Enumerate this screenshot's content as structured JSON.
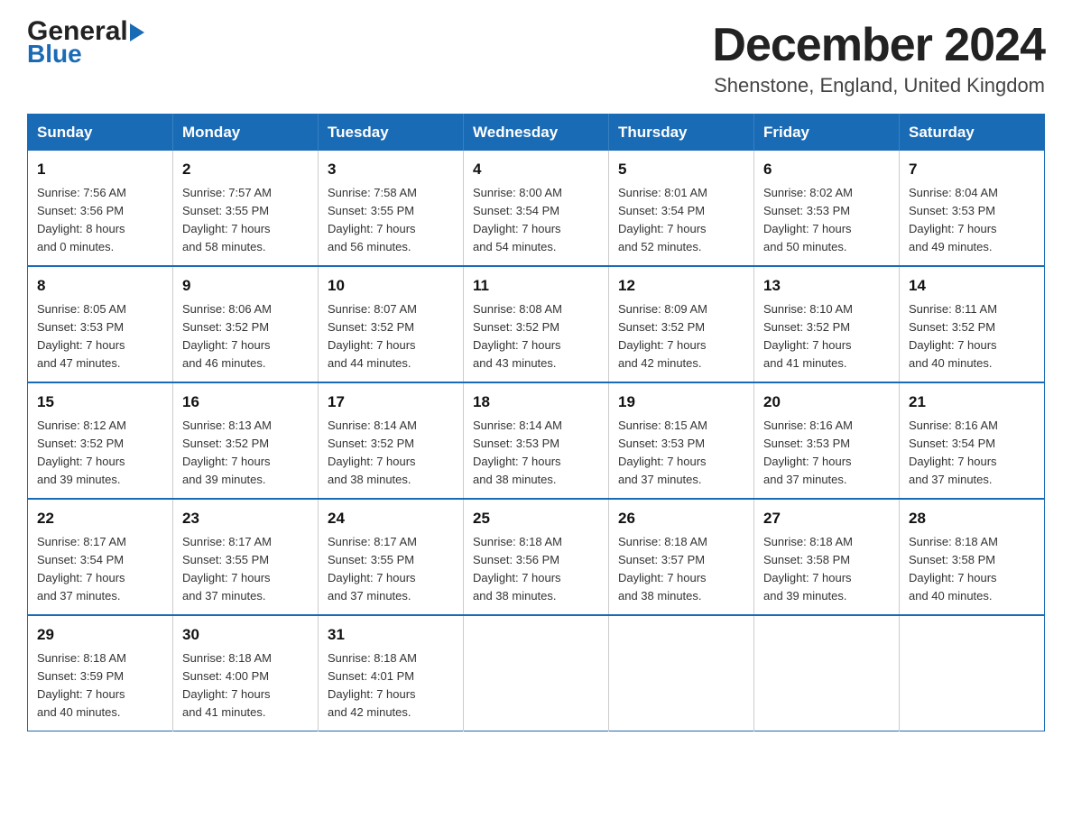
{
  "header": {
    "logo_general": "General",
    "logo_blue": "Blue",
    "title": "December 2024",
    "subtitle": "Shenstone, England, United Kingdom"
  },
  "columns": [
    "Sunday",
    "Monday",
    "Tuesday",
    "Wednesday",
    "Thursday",
    "Friday",
    "Saturday"
  ],
  "weeks": [
    [
      {
        "day": "1",
        "info": "Sunrise: 7:56 AM\nSunset: 3:56 PM\nDaylight: 8 hours\nand 0 minutes."
      },
      {
        "day": "2",
        "info": "Sunrise: 7:57 AM\nSunset: 3:55 PM\nDaylight: 7 hours\nand 58 minutes."
      },
      {
        "day": "3",
        "info": "Sunrise: 7:58 AM\nSunset: 3:55 PM\nDaylight: 7 hours\nand 56 minutes."
      },
      {
        "day": "4",
        "info": "Sunrise: 8:00 AM\nSunset: 3:54 PM\nDaylight: 7 hours\nand 54 minutes."
      },
      {
        "day": "5",
        "info": "Sunrise: 8:01 AM\nSunset: 3:54 PM\nDaylight: 7 hours\nand 52 minutes."
      },
      {
        "day": "6",
        "info": "Sunrise: 8:02 AM\nSunset: 3:53 PM\nDaylight: 7 hours\nand 50 minutes."
      },
      {
        "day": "7",
        "info": "Sunrise: 8:04 AM\nSunset: 3:53 PM\nDaylight: 7 hours\nand 49 minutes."
      }
    ],
    [
      {
        "day": "8",
        "info": "Sunrise: 8:05 AM\nSunset: 3:53 PM\nDaylight: 7 hours\nand 47 minutes."
      },
      {
        "day": "9",
        "info": "Sunrise: 8:06 AM\nSunset: 3:52 PM\nDaylight: 7 hours\nand 46 minutes."
      },
      {
        "day": "10",
        "info": "Sunrise: 8:07 AM\nSunset: 3:52 PM\nDaylight: 7 hours\nand 44 minutes."
      },
      {
        "day": "11",
        "info": "Sunrise: 8:08 AM\nSunset: 3:52 PM\nDaylight: 7 hours\nand 43 minutes."
      },
      {
        "day": "12",
        "info": "Sunrise: 8:09 AM\nSunset: 3:52 PM\nDaylight: 7 hours\nand 42 minutes."
      },
      {
        "day": "13",
        "info": "Sunrise: 8:10 AM\nSunset: 3:52 PM\nDaylight: 7 hours\nand 41 minutes."
      },
      {
        "day": "14",
        "info": "Sunrise: 8:11 AM\nSunset: 3:52 PM\nDaylight: 7 hours\nand 40 minutes."
      }
    ],
    [
      {
        "day": "15",
        "info": "Sunrise: 8:12 AM\nSunset: 3:52 PM\nDaylight: 7 hours\nand 39 minutes."
      },
      {
        "day": "16",
        "info": "Sunrise: 8:13 AM\nSunset: 3:52 PM\nDaylight: 7 hours\nand 39 minutes."
      },
      {
        "day": "17",
        "info": "Sunrise: 8:14 AM\nSunset: 3:52 PM\nDaylight: 7 hours\nand 38 minutes."
      },
      {
        "day": "18",
        "info": "Sunrise: 8:14 AM\nSunset: 3:53 PM\nDaylight: 7 hours\nand 38 minutes."
      },
      {
        "day": "19",
        "info": "Sunrise: 8:15 AM\nSunset: 3:53 PM\nDaylight: 7 hours\nand 37 minutes."
      },
      {
        "day": "20",
        "info": "Sunrise: 8:16 AM\nSunset: 3:53 PM\nDaylight: 7 hours\nand 37 minutes."
      },
      {
        "day": "21",
        "info": "Sunrise: 8:16 AM\nSunset: 3:54 PM\nDaylight: 7 hours\nand 37 minutes."
      }
    ],
    [
      {
        "day": "22",
        "info": "Sunrise: 8:17 AM\nSunset: 3:54 PM\nDaylight: 7 hours\nand 37 minutes."
      },
      {
        "day": "23",
        "info": "Sunrise: 8:17 AM\nSunset: 3:55 PM\nDaylight: 7 hours\nand 37 minutes."
      },
      {
        "day": "24",
        "info": "Sunrise: 8:17 AM\nSunset: 3:55 PM\nDaylight: 7 hours\nand 37 minutes."
      },
      {
        "day": "25",
        "info": "Sunrise: 8:18 AM\nSunset: 3:56 PM\nDaylight: 7 hours\nand 38 minutes."
      },
      {
        "day": "26",
        "info": "Sunrise: 8:18 AM\nSunset: 3:57 PM\nDaylight: 7 hours\nand 38 minutes."
      },
      {
        "day": "27",
        "info": "Sunrise: 8:18 AM\nSunset: 3:58 PM\nDaylight: 7 hours\nand 39 minutes."
      },
      {
        "day": "28",
        "info": "Sunrise: 8:18 AM\nSunset: 3:58 PM\nDaylight: 7 hours\nand 40 minutes."
      }
    ],
    [
      {
        "day": "29",
        "info": "Sunrise: 8:18 AM\nSunset: 3:59 PM\nDaylight: 7 hours\nand 40 minutes."
      },
      {
        "day": "30",
        "info": "Sunrise: 8:18 AM\nSunset: 4:00 PM\nDaylight: 7 hours\nand 41 minutes."
      },
      {
        "day": "31",
        "info": "Sunrise: 8:18 AM\nSunset: 4:01 PM\nDaylight: 7 hours\nand 42 minutes."
      },
      {
        "day": "",
        "info": ""
      },
      {
        "day": "",
        "info": ""
      },
      {
        "day": "",
        "info": ""
      },
      {
        "day": "",
        "info": ""
      }
    ]
  ],
  "colors": {
    "header_bg": "#1a6bb5",
    "border": "#1a6bb5",
    "text_dark": "#222222",
    "text_blue": "#1a6bb5"
  }
}
